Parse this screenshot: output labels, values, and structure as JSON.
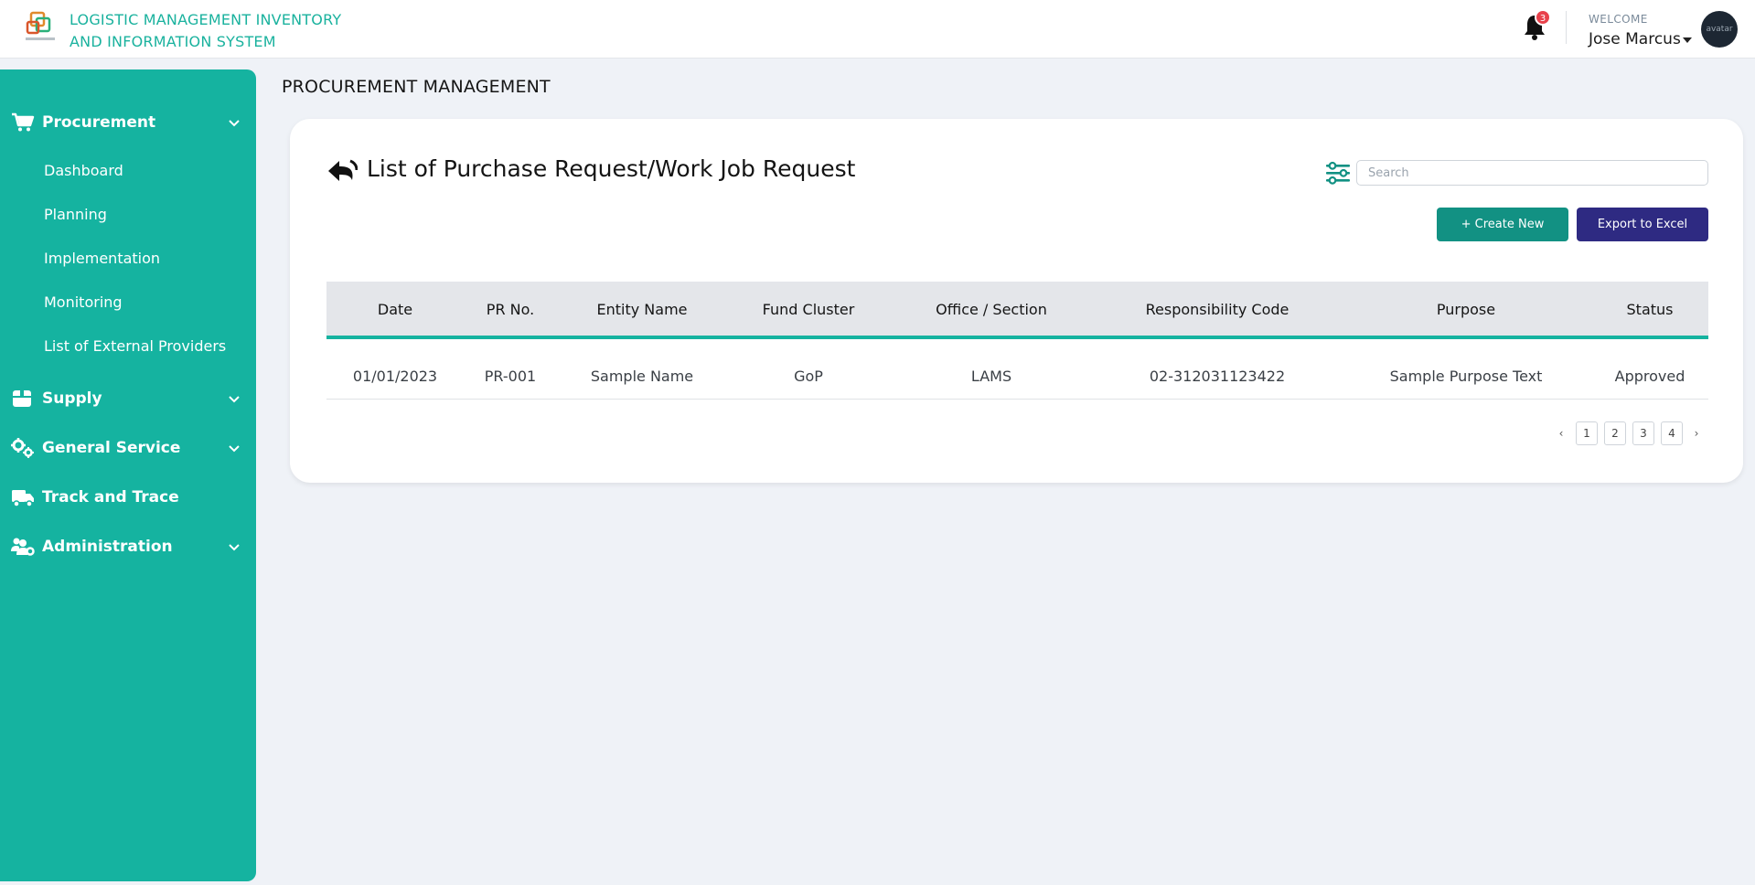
{
  "header": {
    "app_title_line1": "LOGISTIC MANAGEMENT INVENTORY",
    "app_title_line2": "AND INFORMATION SYSTEM",
    "notification_count": "3",
    "welcome_label": "WELCOME",
    "user_name": "Jose Marcus",
    "avatar_alt": "avatar"
  },
  "sidebar": {
    "sections": [
      {
        "label": "Procurement",
        "icon": "cart-icon",
        "expandable": true
      },
      {
        "label": "Supply",
        "icon": "box-icon",
        "expandable": true
      },
      {
        "label": "General Service",
        "icon": "gears-icon",
        "expandable": true
      },
      {
        "label": "Track and Trace",
        "icon": "truck-icon",
        "expandable": false
      },
      {
        "label": "Administration",
        "icon": "users-cog-icon",
        "expandable": true
      }
    ],
    "procurement_items": [
      "Dashboard",
      "Planning",
      "Implementation",
      "Monitoring",
      "List of External Providers"
    ]
  },
  "main": {
    "page_title": "PROCUREMENT MANAGEMENT",
    "card_title": "List of Purchase Request/Work Job Request",
    "search_placeholder": "Search",
    "create_button": "+ Create New",
    "export_button": "Export to Excel",
    "table": {
      "columns": [
        "Date",
        "PR No.",
        "Entity Name",
        "Fund Cluster",
        "Office / Section",
        "Responsibility Code",
        "Purpose",
        "Status"
      ],
      "rows": [
        [
          "01/01/2023",
          "PR-001",
          "Sample Name",
          "GoP",
          "LAMS",
          "02-312031123422",
          "Sample Purpose Text",
          "Approved"
        ]
      ]
    },
    "pagination": {
      "prev": "‹",
      "pages": [
        "1",
        "2",
        "3",
        "4"
      ],
      "next": "›"
    }
  },
  "colors": {
    "accent_teal": "#15b3a0",
    "create_button": "#129183",
    "export_button": "#2e2a82",
    "badge_red": "#e8414b"
  }
}
